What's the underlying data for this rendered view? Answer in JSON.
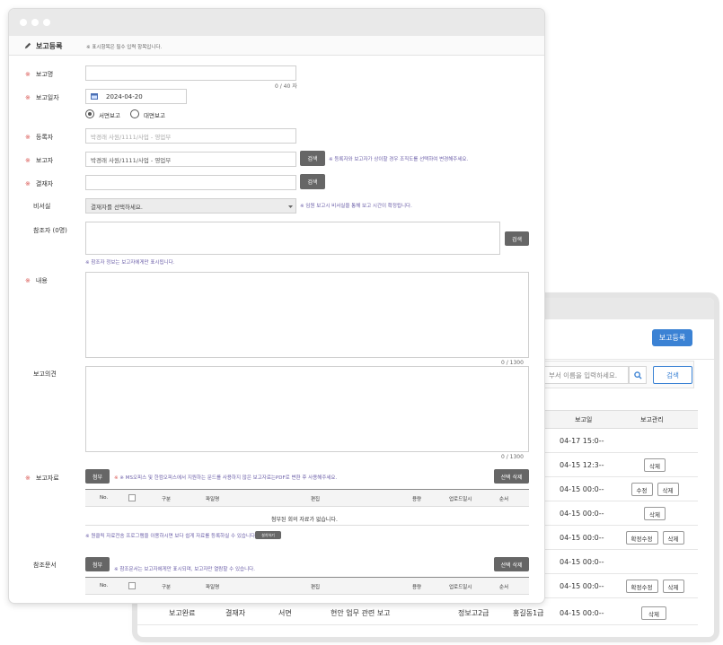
{
  "back": {
    "register_btn": "보고등록",
    "search_placeholder": "부서 이름을 입력하세요.",
    "search_btn": "검색",
    "columns": {
      "report_date": "보고일",
      "manage": "보고관리"
    },
    "rows": [
      {
        "date": "04-17 15:0--",
        "actions": []
      },
      {
        "date": "04-15 12:3--",
        "actions": [
          "삭제"
        ]
      },
      {
        "date": "04-15 00:0--",
        "actions": [
          "수정",
          "삭제"
        ]
      },
      {
        "date": "04-15 00:0--",
        "actions": [
          "삭제"
        ]
      },
      {
        "date": "04-15 00:0--",
        "actions": [
          "확정수정",
          "삭제"
        ]
      },
      {
        "date": "04-15 00:0--",
        "actions": []
      },
      {
        "date": "04-15 00:0--",
        "actions": [
          "확정수정",
          "삭제"
        ]
      }
    ],
    "last_row": {
      "status": "보고완료",
      "role": "결재자",
      "type": "서면",
      "title": "현안 업무 관련 보고",
      "c5": "정보고2급",
      "c6": "홍길동1급",
      "date": "04-15 00:0--",
      "action": "삭제"
    }
  },
  "front": {
    "title": "보고등록",
    "required_note": "※ 표시항목은 필수 입력 항목입니다.",
    "fields": {
      "report_name": {
        "label": "보고명",
        "counter": "0 / 40 자"
      },
      "report_date": {
        "label": "보고일자",
        "value": "2024-04-20"
      },
      "mode": {
        "options": [
          "서면보고",
          "대면보고"
        ]
      },
      "registrant": {
        "label": "등록자",
        "value": "박경래 사원/1111/사업 - 영업부"
      },
      "reporter": {
        "label": "보고자",
        "value": "박경래 사원/1111/사업 - 영업부",
        "button": "검색",
        "note": "※ 등록자와 보고자가 상이할 경우 조직도를 선택하여 변경해주세요."
      },
      "approver": {
        "label": "결재자",
        "button": "검색"
      },
      "secretary": {
        "label": "비서실",
        "value": "결재자를 선택하세요.",
        "note": "※ 임원 보고시 비서실을 통해 보고 시간이 확정됩니다."
      },
      "cc": {
        "label": "참조자 (0명)",
        "button": "검색",
        "note": "※ 참조자 정보는 보고자에게만 표시됩니다."
      },
      "content": {
        "label": "내용",
        "counter": "0   / 1300"
      },
      "opinion": {
        "label": "보고의견",
        "counter": "0   / 1300"
      },
      "attach": {
        "label": "보고자료",
        "button": "첨부",
        "note": "※ MS오피스 및 한컴오피스에서 지원하는 문드를 사용하지 않은 보고자료는PDF로 변환 후 사용해주세요.",
        "delete_btn": "선택 삭제",
        "columns": [
          "No.",
          "구분",
          "파일명",
          "편집",
          "용량",
          "업로드일시",
          "순서"
        ],
        "empty": "첨부된 회의 자료가 없습니다.",
        "footnote": "※ 원클릭 자료전송 프로그램을 이용하시면 보다 쉽게 자료를 등록하실 수 있습니다.",
        "install_btn": "설치하기"
      },
      "refdoc": {
        "label": "참조문서",
        "button": "첨부",
        "note": "※ 참조문서는 보고자에게만 표시되며, 보고자만 열람할 수 있습니다.",
        "delete_btn": "선택 삭제",
        "columns": [
          "No.",
          "구분",
          "파일명",
          "편집",
          "용량",
          "업로드일시",
          "순서"
        ]
      }
    }
  }
}
